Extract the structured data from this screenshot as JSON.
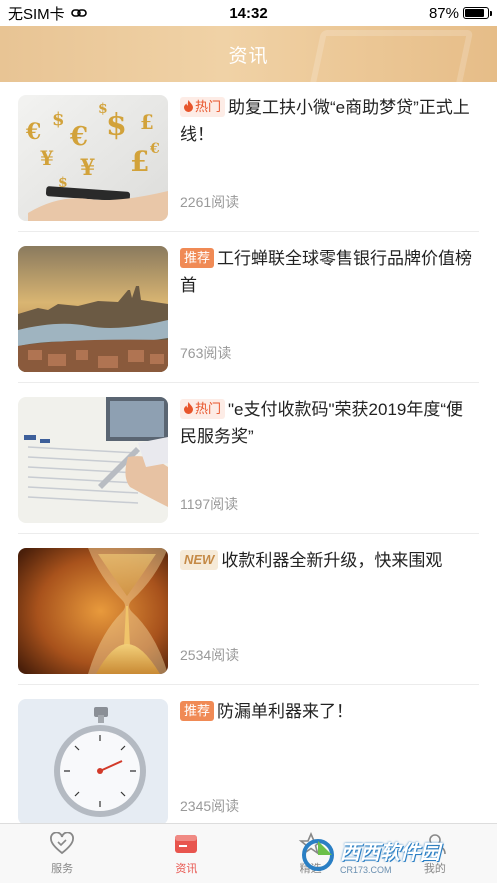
{
  "status": {
    "carrier": "无SIM卡",
    "time": "14:32",
    "battery": "87%",
    "battery_level": 0.87
  },
  "header": {
    "title": "资讯"
  },
  "articles": [
    {
      "tag": "热门",
      "tag_type": "hot",
      "title": "助复工扶小微“e商助梦贷”正式上线！",
      "reads": "2261阅读",
      "thumb": "currency"
    },
    {
      "tag": "推荐",
      "tag_type": "rec",
      "title": "工行蝉联全球零售银行品牌价值榜首",
      "reads": "763阅读",
      "thumb": "city"
    },
    {
      "tag": "热门",
      "tag_type": "hot",
      "title": "\"e支付收款码\"荣获2019年度“便民服务奖”",
      "reads": "1197阅读",
      "thumb": "document"
    },
    {
      "tag": "NEW",
      "tag_type": "new",
      "title": "收款利器全新升级，快来围观",
      "reads": "2534阅读",
      "thumb": "hourglass"
    },
    {
      "tag": "推荐",
      "tag_type": "rec",
      "title": "防漏单利器来了！",
      "reads": "2345阅读",
      "thumb": "stopwatch"
    }
  ],
  "tabs": [
    {
      "label": "服务",
      "icon": "heart-icon",
      "active": false
    },
    {
      "label": "资讯",
      "icon": "news-icon",
      "active": true
    },
    {
      "label": "精选",
      "icon": "star-icon",
      "active": false
    },
    {
      "label": "我的",
      "icon": "user-icon",
      "active": false
    }
  ],
  "watermark": {
    "text": "西西软件园",
    "sub": "CR173.COM"
  },
  "colors": {
    "accent": "#e8554e",
    "header": "#ecc897",
    "hot": "#e8552b",
    "recommend": "#f08a55"
  }
}
